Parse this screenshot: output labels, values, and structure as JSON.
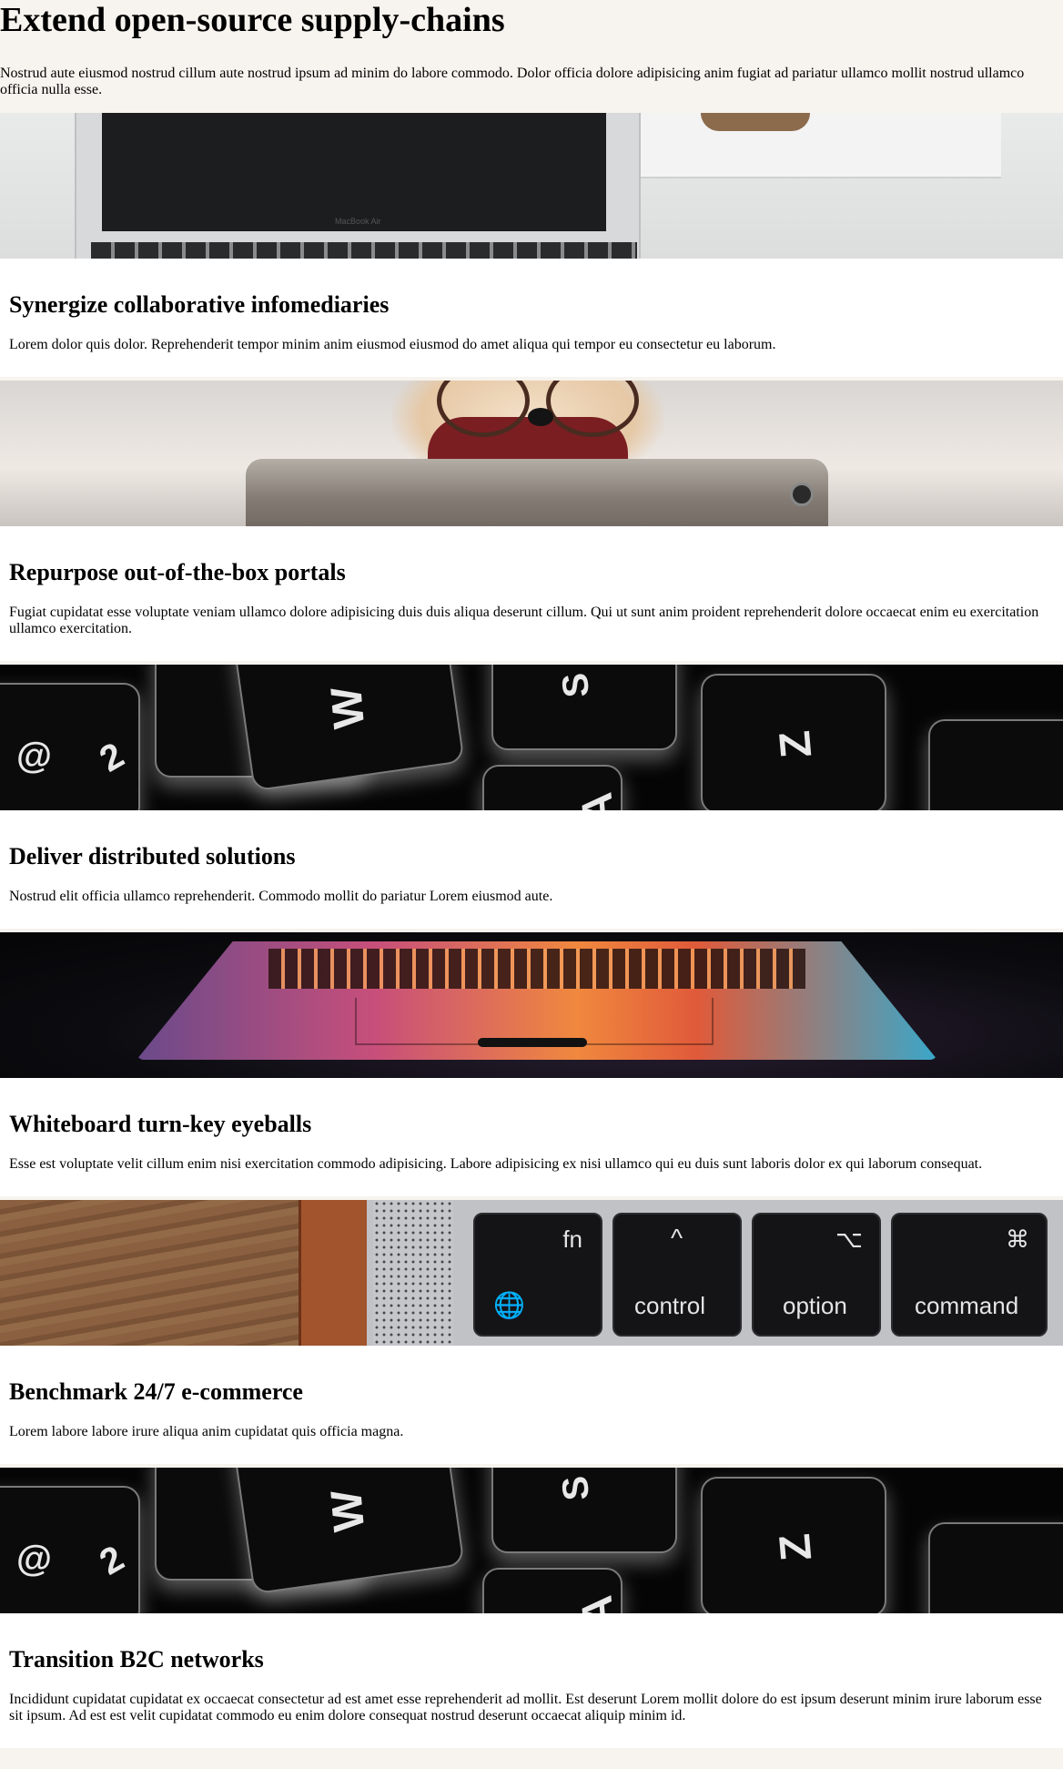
{
  "header": {
    "title": "Extend open-source supply-chains",
    "description": "Nostrud aute eiusmod nostrud cillum aute nostrud ipsum ad minim do labore commodo. Dolor officia dolore adipisicing anim fugiat ad pariatur ullamco mollit nostrud ullamco officia nulla esse."
  },
  "cards": [
    {
      "image": "laptop-macbook-air",
      "image_label": "MacBook Air",
      "title": "Synergize collaborative infomediaries",
      "body": "Lorem dolor quis dolor. Reprehenderit tempor minim anim eiusmod eiusmod do amet aliqua qui tempor eu consectetur eu laborum."
    },
    {
      "image": "dog-with-glasses-tablet",
      "title": "Repurpose out-of-the-box portals",
      "body": "Fugiat cupidatat esse voluptate veniam ullamco dolore adipisicing duis duis aliqua deserunt cillum. Qui ut sunt anim proident reprehenderit dolore occaecat enim eu exercitation ullamco exercitation."
    },
    {
      "image": "backlit-keyboard",
      "title": "Deliver distributed solutions",
      "body": "Nostrud elit officia ullamco reprehenderit. Commodo mollit do pariatur Lorem eiusmod aute."
    },
    {
      "image": "macbook-pro-colorful-glow",
      "title": "Whiteboard turn-key eyeballs",
      "body": "Esse est voluptate velit cillum enim nisi exercitation commodo adipisicing. Labore adipisicing ex nisi ullamco qui eu duis sunt laboris dolor ex qui laborum consequat."
    },
    {
      "image": "macbook-modifier-keys",
      "keys": [
        "fn",
        "control",
        "option",
        "command"
      ],
      "title": "Benchmark 24/7 e-commerce",
      "body": "Lorem labore labore irure aliqua anim cupidatat quis officia magna."
    },
    {
      "image": "backlit-keyboard",
      "title": "Transition B2C networks",
      "body": "Incididunt cupidatat cupidatat ex occaecat consectetur ad est amet esse reprehenderit ad mollit. Est deserunt Lorem mollit dolore do est ipsum deserunt minim irure laborum esse sit ipsum. Ad est est velit cupidatat commodo eu enim dolore consequat nostrud deserunt occaecat aliquip minim id."
    }
  ]
}
